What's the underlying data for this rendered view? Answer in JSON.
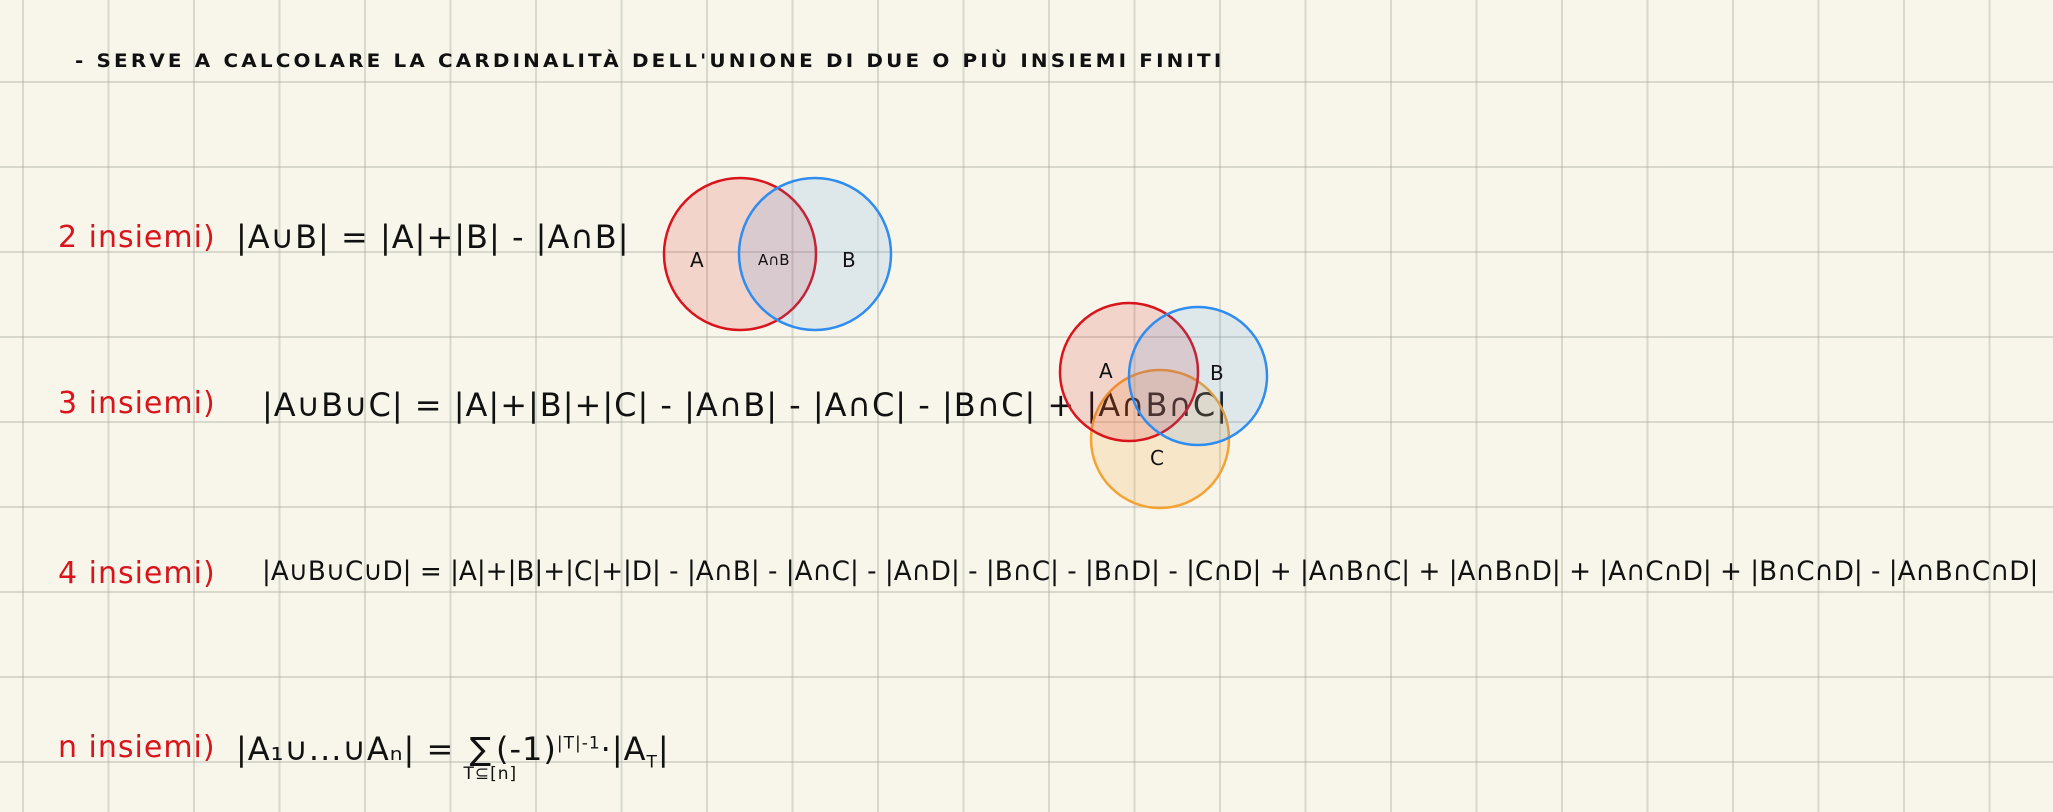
{
  "intro": "- SERVE A CALCOLARE LA CARDINALITÀ DELL'UNIONE DI DUE O PIÙ INSIEMI FINITI",
  "cases": [
    {
      "label": "2 insiemi)",
      "formula": "|A∪B| = |A|+|B| - |A∩B|"
    },
    {
      "label": "3 insiemi)",
      "formula": "|A∪B∪C| = |A|+|B|+|C| - |A∩B| - |A∩C| - |B∩C| + |A∩B∩C|"
    },
    {
      "label": "4 insiemi)",
      "formula": "|A∪B∪C∪D| = |A|+|B|+|C|+|D| - |A∩B| - |A∩C| - |A∩D| - |B∩C| - |B∩D| - |C∩D| + |A∩B∩C| + |A∩B∩D| + |A∩C∩D| + |B∩C∩D| - |A∩B∩C∩D|"
    },
    {
      "label": "n insiemi)",
      "lhs": "|A₁∪...∪Aₙ| =",
      "sum": "∑",
      "sum_sub": "T⊆[n]",
      "term": "(-1)",
      "exponent": "|T|-1",
      "rest": "·|A",
      "rest_sub": "T",
      "close": "|"
    }
  ],
  "venn2": {
    "labels": [
      "A",
      "A∩B",
      "B"
    ]
  },
  "venn3": {
    "labels": [
      "A",
      "B",
      "C"
    ]
  },
  "colors": {
    "red": "#d8141c",
    "blue": "#2f8cf0",
    "orange": "#f5a234"
  }
}
